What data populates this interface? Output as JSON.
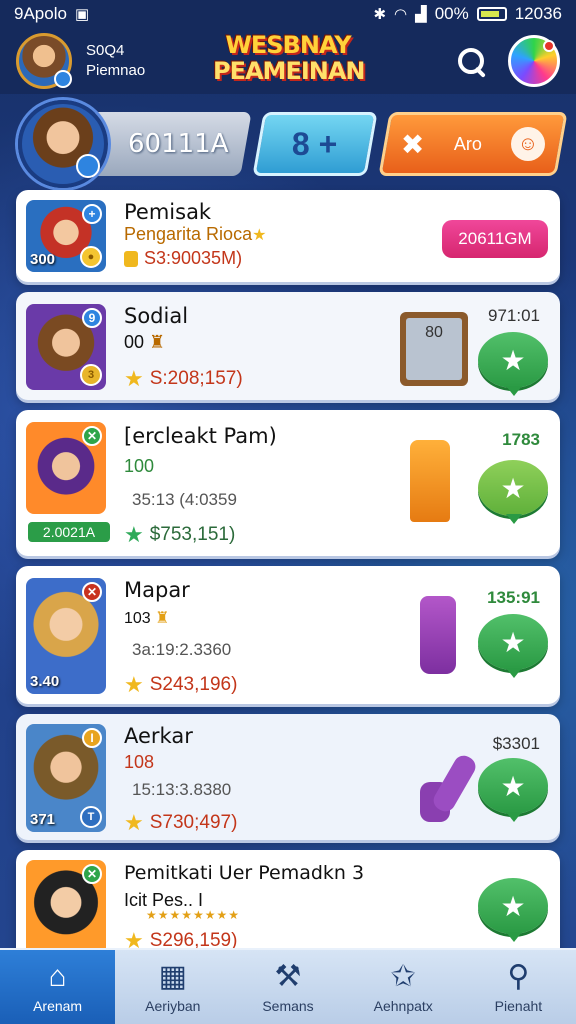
{
  "status_bar": {
    "left_text": "9Apolo",
    "battery_pct": "00%",
    "time": "12036"
  },
  "header": {
    "user_line1": "S0Q4",
    "user_line2": "Piemnao",
    "logo_line1": "WESBNAY",
    "logo_line2": "PEAMEINAN"
  },
  "top_panel": {
    "score": "60111A",
    "plus_label": "8 +",
    "action_label": "Aro"
  },
  "items": [
    {
      "title": "Pemisak",
      "subtitle": "Pengarita Rioca",
      "meta": "S3:90035M)",
      "thumb_label": "300",
      "thumb_tag": "+",
      "button_label": "20611GM"
    },
    {
      "title": "Sodial",
      "subtitle": "00",
      "rating": "S:208;157)",
      "thumb_tag": "9",
      "side_value": "971:01",
      "note_label": "80"
    },
    {
      "title": "[ercleakt Pam)",
      "subtitle": "100",
      "meta": "35:13 (4:0359",
      "rating": "$753,151)",
      "chip_label": "2.0021A",
      "side_value": "1783"
    },
    {
      "title": "Mapar",
      "subtitle": "103",
      "meta": "3a:19:2.3360",
      "rating": "S243,196)",
      "thumb_label": "3.40",
      "side_value": "135:91"
    },
    {
      "title": "Aerkar",
      "subtitle": "108",
      "meta": "15:13:3.8380",
      "rating": "S730;497)",
      "thumb_label": "371",
      "side_value": "$3301"
    },
    {
      "title": "Pemitkati Uer Pemadkn 3",
      "subtitle": "Icit Pes.. I",
      "rating": "S296,159)"
    }
  ],
  "bottom_nav": [
    {
      "label": "Arenam",
      "icon": "home-icon"
    },
    {
      "label": "Aeriyban",
      "icon": "calendar-icon"
    },
    {
      "label": "Semans",
      "icon": "tools-icon"
    },
    {
      "label": "Aehnpatx",
      "icon": "star-badge-icon"
    },
    {
      "label": "Pienaht",
      "icon": "search-icon"
    }
  ],
  "colors": {
    "accent_blue": "#2e7fd8",
    "pink_button": "#e03282",
    "green_button": "#2fa54a",
    "orange_action": "#f07c28"
  }
}
